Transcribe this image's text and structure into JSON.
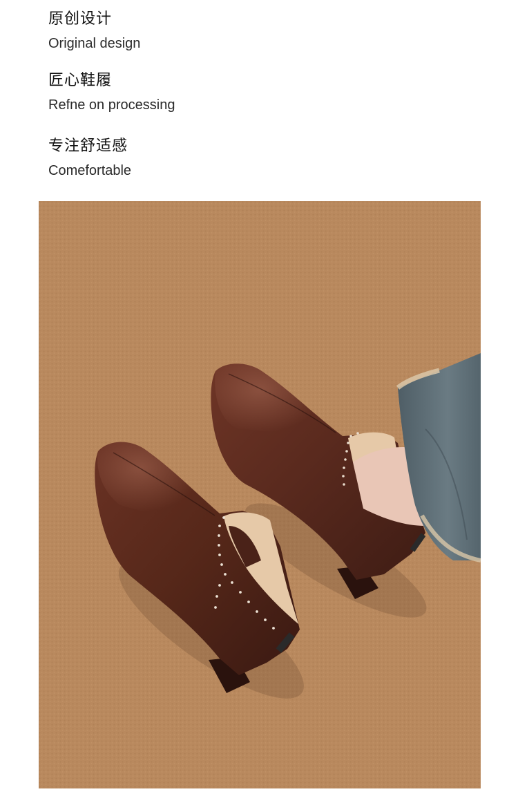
{
  "features": [
    {
      "zh": "原创设计",
      "en": "Original design"
    },
    {
      "zh": "匠心鞋履",
      "en": "Refne on processing"
    },
    {
      "zh": "专注舒适感",
      "en": "Comefortable"
    }
  ],
  "photo": {
    "subject": "two brown leather ankle boots with studded trim on a tan carpet, denim jeans hem at right",
    "colors": {
      "carpet": "#b8895e",
      "boot_leather": "#5a2a1e",
      "boot_lining": "#e6c9a8",
      "denim": "#5a6b73",
      "skin": "#e9c6b6"
    }
  }
}
